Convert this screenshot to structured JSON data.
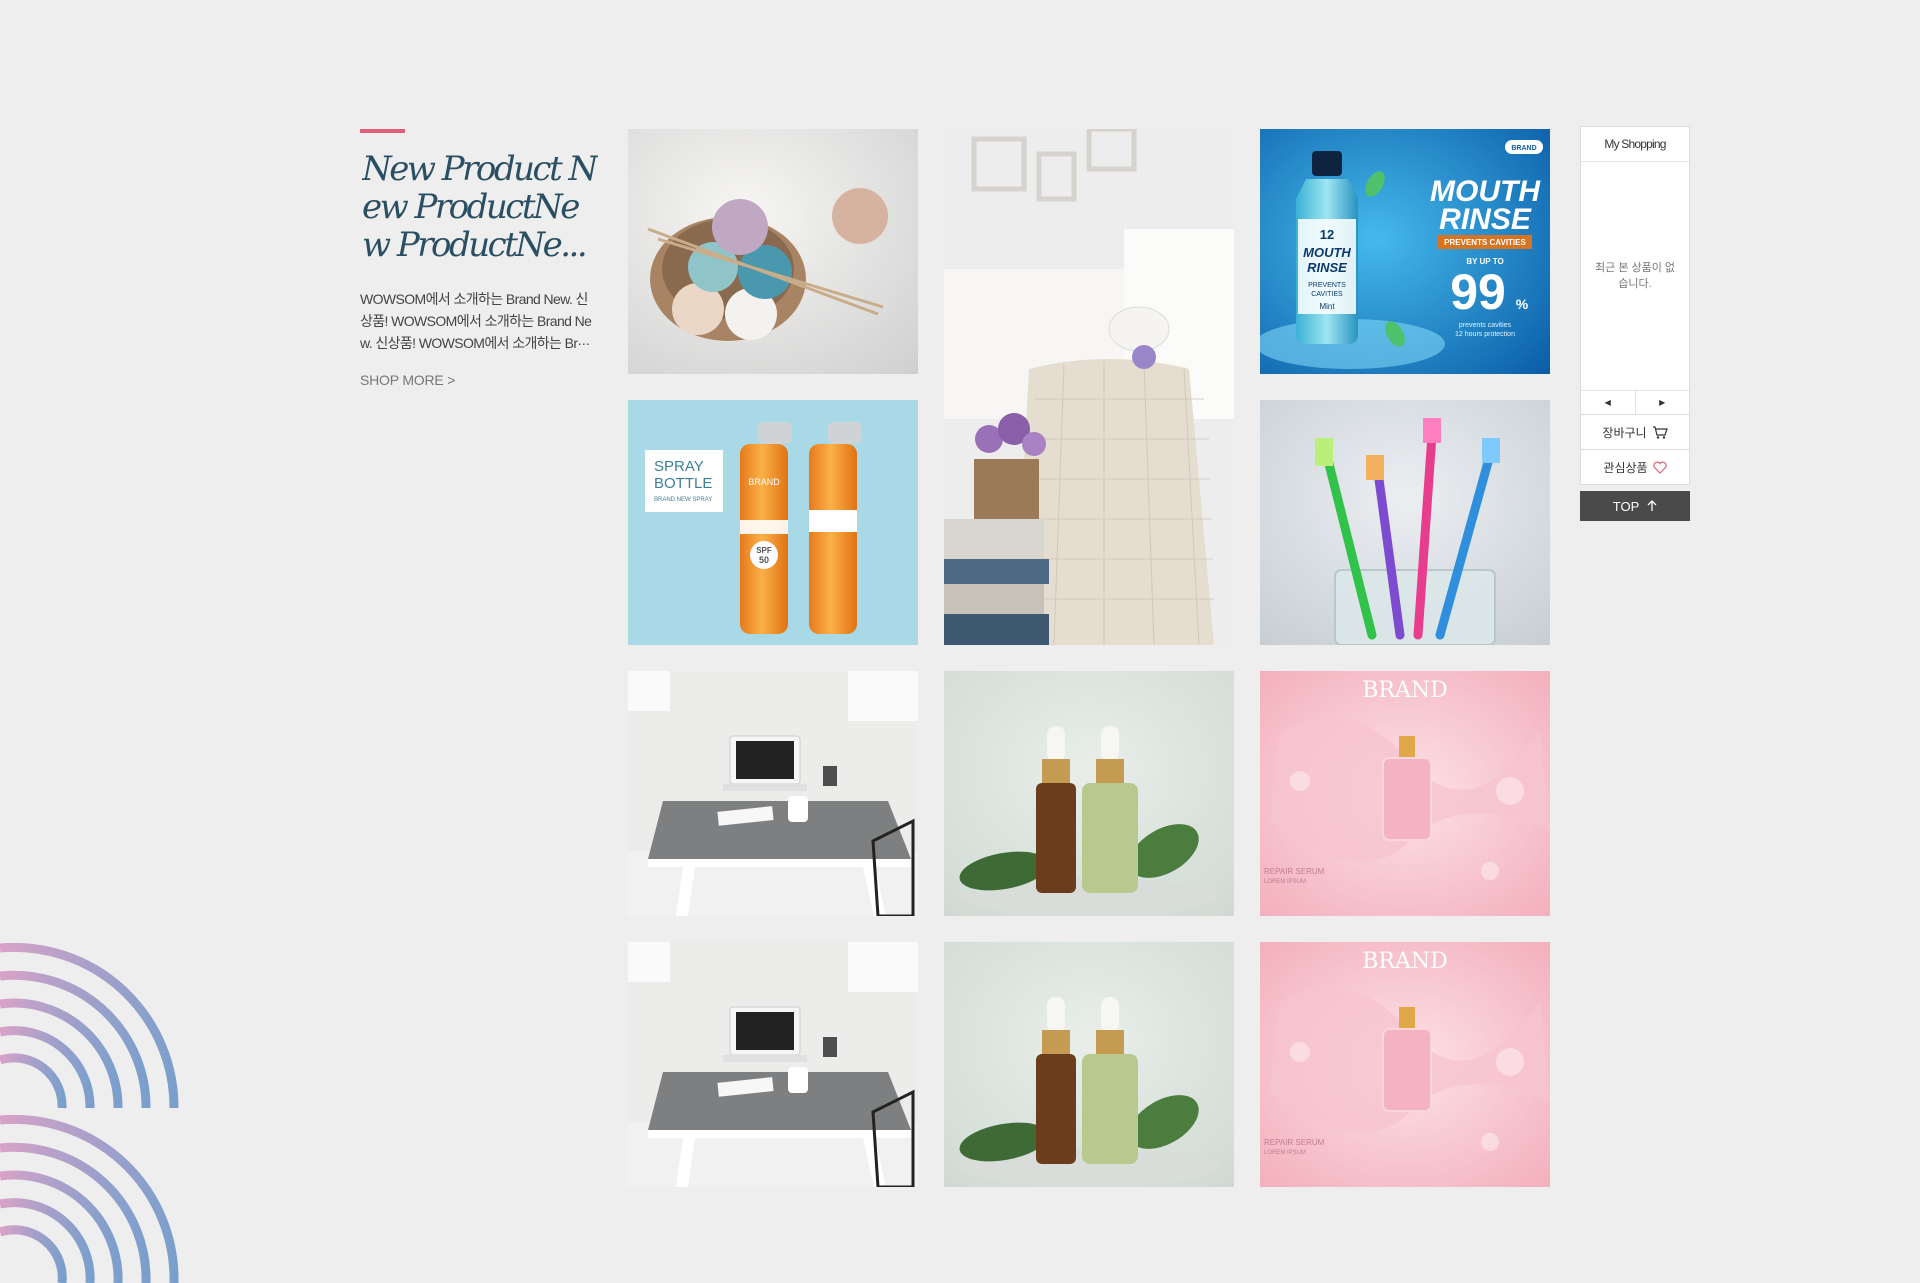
{
  "intro": {
    "title": "New Product New ProductNew ProductNe...",
    "description": "WOWSOM에서 소개하는 Brand New. 신상품! WOWSOM에서 소개하는 Brand New. 신상품! WOWSOM에서 소개하는 Br···",
    "more_label": "SHOP MORE >",
    "accent": "#e0607a",
    "title_color": "#2a4f63"
  },
  "products": [
    {
      "name": "yarn-basket",
      "icon": "yarn-basket-image"
    },
    {
      "name": "living-room-table",
      "icon": "living-room-image"
    },
    {
      "name": "mouthwash",
      "icon": "mouthwash-ad-image",
      "brand": "BRAND",
      "headline_1": "MOUTH",
      "headline_2": "RINSE",
      "badge": "PREVENTS CAVITIES",
      "by_up_to": "BY UP TO",
      "percent": "99",
      "percent_sign": "%",
      "sub_1": "prevents cavities",
      "sub_2": "12 hours protection",
      "bottle_12": "12",
      "bottle_name_1": "MOUTH",
      "bottle_name_2": "RINSE",
      "bottle_note_1": "PREVENTS",
      "bottle_note_2": "CAVITIES",
      "bottle_flavor": "Mint"
    },
    {
      "name": "spray-bottles",
      "icon": "spray-bottles-image",
      "label_1": "SPRAY",
      "label_2": "BOTTLE",
      "label_3": "BRAND NEW SPRAY",
      "can_brand": "BRAND",
      "spf": "SPF",
      "spf_num": "50"
    },
    {
      "name": "toothbrushes",
      "icon": "toothbrush-image"
    },
    {
      "name": "desk-laptop-1",
      "icon": "desk-laptop-image"
    },
    {
      "name": "serum-bottles-1",
      "icon": "serum-bottles-image"
    },
    {
      "name": "perfume-ad-1",
      "icon": "perfume-ad-image",
      "brand": "BRAND",
      "caption_1": "REPAIR SERUM",
      "caption_2": "LOREM IPSUM"
    },
    {
      "name": "desk-laptop-2",
      "icon": "desk-laptop-image"
    },
    {
      "name": "serum-bottles-2",
      "icon": "serum-bottles-image"
    },
    {
      "name": "perfume-ad-2",
      "icon": "perfume-ad-image",
      "brand": "BRAND",
      "caption_1": "REPAIR SERUM",
      "caption_2": "LOREM IPSUM"
    }
  ],
  "my_shopping": {
    "title": "My Shopping",
    "empty_text": "최근 본 상품이 없습니다.",
    "prev_icon": "◀",
    "next_icon": "▶",
    "cart_label": "장바구니",
    "wishlist_label": "관심상품",
    "top_label": "TOP"
  }
}
